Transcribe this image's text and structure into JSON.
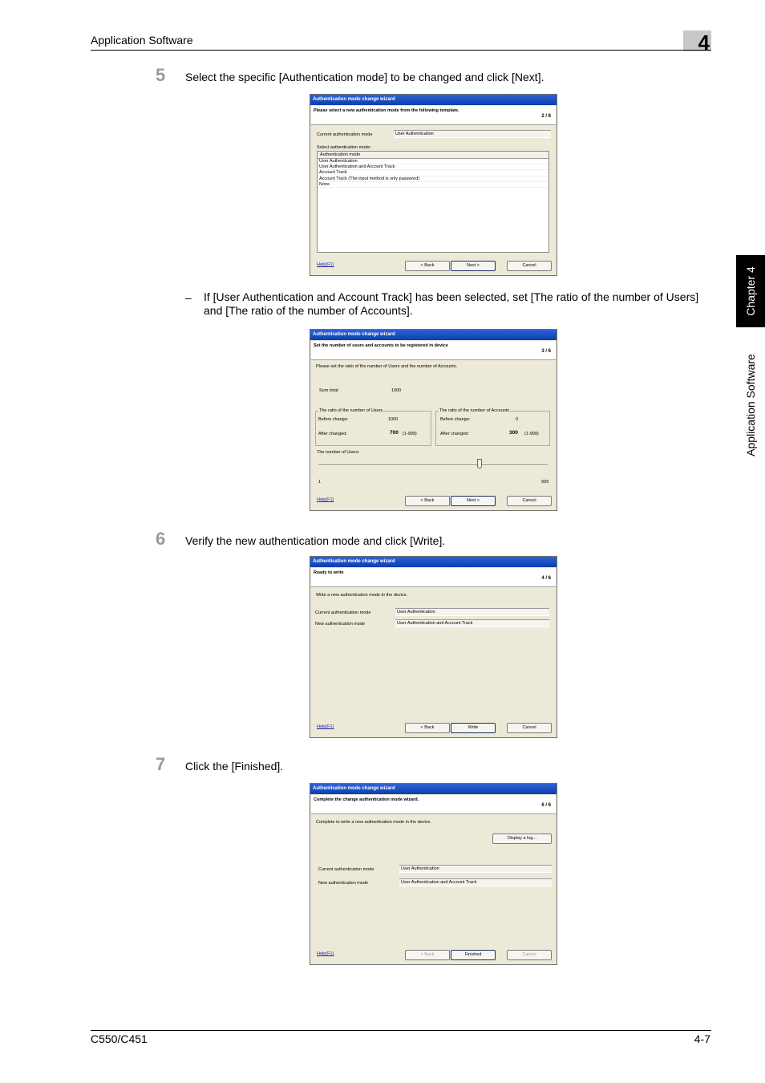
{
  "header": {
    "title": "Application Software",
    "chapter_number": "4"
  },
  "side": {
    "tab": "Chapter 4",
    "section": "Application Software"
  },
  "steps": {
    "s5": {
      "num": "5",
      "text": "Select the specific [Authentication mode] to be changed and click [Next]."
    },
    "bullet": {
      "mark": "–",
      "text": "If [User Authentication and Account Track] has been selected, set [The ratio of the number of Users] and [The ratio of the number of Accounts]."
    },
    "s6": {
      "num": "6",
      "text": "Verify the new authentication mode and click [Write]."
    },
    "s7": {
      "num": "7",
      "text": "Click the [Finished]."
    }
  },
  "dialog1": {
    "title": "Authentication mode change wizard",
    "heading": "Please select a new authentication mode from the following template.",
    "page": "2 / 6",
    "current_label": "Current authentication mode",
    "current_value": "User Authentication",
    "select_label": "Select authentication mode:",
    "list_header": "Authentication mode",
    "items": [
      "User Authentication",
      "User Authentication and Account Track",
      "Account Track",
      "Account Track (The input method is only password)",
      "None"
    ],
    "help": "Help(F1)",
    "back": "< Back",
    "next": "Next >",
    "cancel": "Cancel"
  },
  "dialog2": {
    "title": "Authentication mode change wizard",
    "heading": "Set the number of users and accounts to be registered in device",
    "page": "3 / 6",
    "intro": "Please set the ratio of the number of Users and the number of Accounts.",
    "sum_label": "Sum total:",
    "sum_value": "1000",
    "users_group": "The ratio of the number of Users",
    "users_before_label": "Before change:",
    "users_before": "1000",
    "users_after_label": "After changed:",
    "users_after": "700",
    "users_range": "(1-999)",
    "acc_group": "The ratio of the number of Accounts",
    "acc_before_label": "Before change:",
    "acc_before": "0",
    "acc_after_label": "After changed:",
    "acc_after": "300",
    "acc_range": "(1-999)",
    "slider_label": "The number of Users:",
    "slider_min": "1",
    "slider_max": "999",
    "help": "Help(F1)",
    "back": "< Back",
    "next": "Next >",
    "cancel": "Cancel"
  },
  "dialog3": {
    "title": "Authentication mode change wizard",
    "heading": "Ready to write",
    "page": "4 / 6",
    "intro": "Write a new authentication mode to the device.",
    "current_label": "Current authentication mode",
    "current_value": "User Authentication",
    "new_label": "New authentication mode",
    "new_value": "User Authentication and Account Track",
    "help": "Help(F1)",
    "back": "< Back",
    "write": "Write",
    "cancel": "Cancel"
  },
  "dialog4": {
    "title": "Authentication mode change wizard",
    "heading": "Complete the change authentication mode wizard.",
    "page": "6 / 6",
    "intro": "Complete to write a new authentication mode in the device.",
    "log_button": "Display a log...",
    "current_label": "Current authentication mode",
    "current_value": "User Authentication",
    "new_label": "New authentication mode",
    "new_value": "User Authentication and Account Track",
    "help": "Help(F1)",
    "back": "< Back",
    "finished": "Finished",
    "cancel": "Cancel"
  },
  "footer": {
    "model": "C550/C451",
    "page": "4-7"
  }
}
